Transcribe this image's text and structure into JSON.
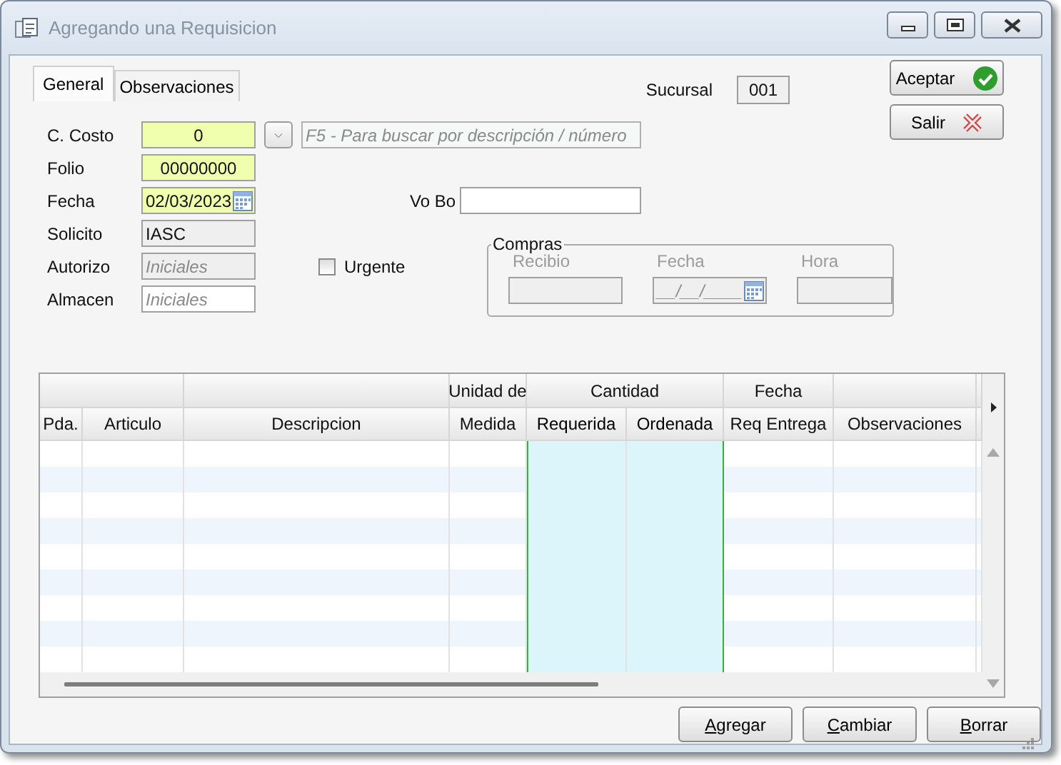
{
  "window": {
    "title": "Agregando una Requisicion"
  },
  "tabs": [
    {
      "label": "General",
      "selected": true
    },
    {
      "label": "Observaciones",
      "selected": false
    }
  ],
  "sucursal": {
    "label": "Sucursal",
    "value": "001"
  },
  "actions": [
    {
      "label": "Aceptar",
      "kind": "accept"
    },
    {
      "label": "Salir",
      "kind": "exit"
    }
  ],
  "form": {
    "fields": [
      {
        "label": "C. Costo",
        "kind": "required",
        "value": "0"
      },
      {
        "label": "Folio",
        "kind": "required",
        "value": "00000000"
      },
      {
        "label": "Fecha",
        "kind": "date",
        "value": "02/03/2023"
      },
      {
        "label": "Solicito",
        "kind": "readonly",
        "value": "IASC"
      },
      {
        "label": "Autorizo",
        "kind": "readonly",
        "placeholder": "Iniciales"
      },
      {
        "label": "Almacen",
        "kind": "normal",
        "placeholder": "Iniciales"
      }
    ],
    "search_hint": {
      "placeholder": "F5 - Para buscar por descripción / número"
    },
    "vo_bo": {
      "label": "Vo Bo"
    },
    "urgente": {
      "label": "Urgente",
      "checked": false
    },
    "compras": {
      "title": "Compras",
      "disabled": true,
      "fields": [
        {
          "label": "Recibio",
          "kind": "text"
        },
        {
          "label": "Fecha",
          "kind": "date",
          "placeholder": "__/__/____"
        },
        {
          "label": "Hora",
          "kind": "text"
        }
      ]
    }
  },
  "grid": {
    "columns": [
      {
        "children": [
          {
            "label": "Pda."
          },
          {
            "label": "Articulo"
          }
        ]
      },
      {
        "children": [
          {
            "label": "Descripcion"
          }
        ]
      },
      {
        "label": "Unidad de",
        "children": [
          {
            "label": "Medida"
          }
        ]
      },
      {
        "label": "Cantidad",
        "children": [
          {
            "label": "Requerida",
            "highlighted": true
          },
          {
            "label": "Ordenada",
            "highlighted": true
          }
        ]
      },
      {
        "label": "Fecha",
        "children": [
          {
            "label": "Req Entrega"
          }
        ]
      },
      {
        "children": [
          {
            "label": "Observaciones"
          }
        ]
      }
    ]
  },
  "buttons": [
    {
      "label": "Agregar",
      "mnemonic": true
    },
    {
      "label": "Cambiar",
      "mnemonic": true
    },
    {
      "label": "Borrar",
      "mnemonic": true
    }
  ]
}
